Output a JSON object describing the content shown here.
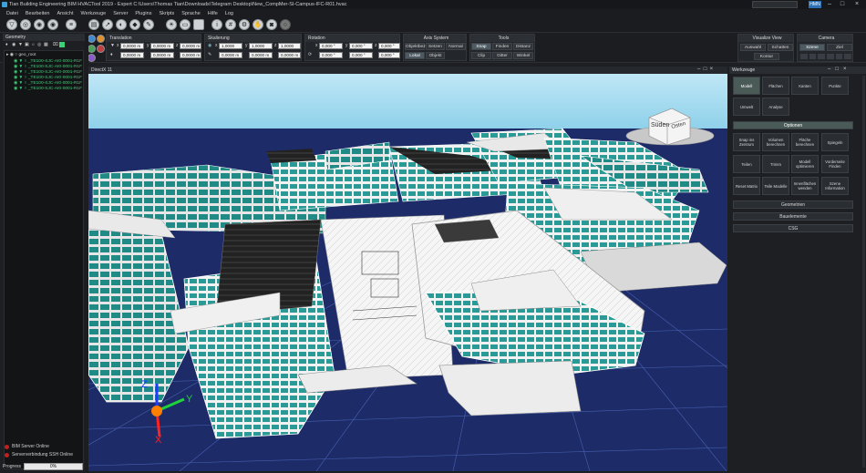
{
  "title": "Tian Building Engineering BIM HVACTool 2019 - Expert   C:\\Users\\Thomas Tian\\Downloads\\Telegram Desktop\\New_CompMer-SI-Campus-IFC-R01.hvac",
  "user_badge": "HMN",
  "menu": [
    "Datei",
    "Bearbeiten",
    "Ansicht",
    "Werkzeuge",
    "Server",
    "Plugins",
    "Skripts",
    "Sprache",
    "Hilfe",
    "Log"
  ],
  "ribbon": {
    "translation": {
      "label": "Translation",
      "x": "0,0000 m",
      "y": "0,0000 m",
      "z": "0,0000 m",
      "x2": "0,0000 m",
      "y2": "0,0000 m",
      "z2": "0,0000 m"
    },
    "skalierung": {
      "label": "Skalierung",
      "x": "1,0000",
      "y": "1,0000",
      "z": "1,0000",
      "x2": "0,0000 m",
      "y2": "0,0000 m",
      "z2": "0,0000 m"
    },
    "rotation": {
      "label": "Rotation",
      "x": "0,000 °",
      "y": "0,000 °",
      "z": "0,000 °",
      "x2": "0,000 °",
      "y2": "0,000 °",
      "z2": "0,000 °"
    },
    "axis": {
      "label": "Axis System",
      "objektbezug": "Objektbezug",
      "setzen": "Setzen",
      "normal": "Normal",
      "lokal": "Lokal",
      "objekt": "Objekt"
    },
    "tools": {
      "label": "Tools",
      "snap": "Snap",
      "finden": "Finden",
      "distanz": "Distanz",
      "clip": "Clip",
      "gitter": "Gitter",
      "winkel": "Winkel"
    },
    "visualize": {
      "label": "Visualize View",
      "auswahl": "Auswahl",
      "schatten": "Schatten",
      "kontur": "Kontur"
    },
    "camera": {
      "label": "Camera",
      "szene": "Szene",
      "ziel": "Ziel"
    }
  },
  "geometry": {
    "header": "Geometry",
    "root": "geo_root",
    "items": [
      "_TE100-SJC-AI0-0001-R1F",
      "_TE100-SJC-AI0-0001-R1F",
      "_TE100-SJC-AI0-0001-R1F",
      "_TE100-SJC-AI0-0001-R1F",
      "_TE100-SJC-AI0-0001-R1F",
      "_TE100-SJC-AI0-0001-R1F"
    ]
  },
  "status": {
    "server": "BIM Server Online",
    "ssh": "Serververbindung SSH Online",
    "progress_label": "Progress",
    "progress_value": "0%",
    "progress_fraction": 0
  },
  "viewport": {
    "header": "DirectX 11",
    "cube_south": "Süden",
    "cube_east": "Osten",
    "axis_x": "X",
    "axis_y": "Y",
    "axis_z": "Z"
  },
  "werkzeuge": {
    "header": "Werkzeuge",
    "tabs": [
      "Modell",
      "Flächen",
      "Kanten",
      "Punkte",
      "Umwelt",
      "Analyse"
    ],
    "optionen": "Optionen",
    "tools": [
      "Snap ins Zentrum",
      "Volumen berechnen",
      "Fläche berechnen",
      "Spiegeln",
      "Teilen",
      "Trimm",
      "Modell optimieren",
      "Vorderseite Finden",
      "Reset Matrix",
      "Teile Modelle",
      "Innenflächen wenden",
      "Szene Information"
    ],
    "sections": [
      "Geometrien",
      "Bauelemente",
      "CSG"
    ]
  },
  "colors": {
    "sky": "#9fd9ee",
    "ground": "#1d2c68",
    "glass": "#2a9a96",
    "accent_green": "#3fcf77",
    "active": "#4a5a56"
  }
}
